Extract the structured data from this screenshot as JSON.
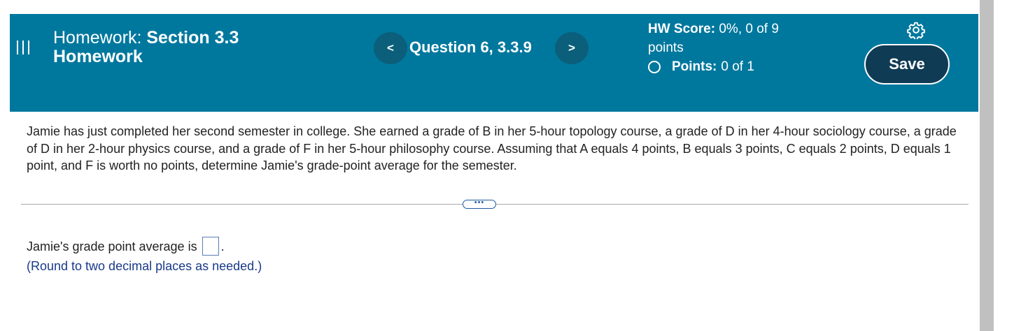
{
  "header": {
    "menu_icon": "hamburger-menu-icon",
    "title_prefix": "Homework: ",
    "title_bold": "Section 3.3 Homework",
    "prev_icon": "chevron-left-icon",
    "prev_glyph": "<",
    "question_label": "Question 6, 3.3.9",
    "next_icon": "chevron-right-icon",
    "next_glyph": ">",
    "hw_score_label": "HW Score:",
    "hw_score_value": "0%, 0 of 9 points",
    "points_label": "Points:",
    "points_value": "0 of 1",
    "settings_icon": "gear-icon",
    "save_label": "Save"
  },
  "colors": {
    "header_bg": "#00789e",
    "nav_button_bg": "#0b5f7b",
    "save_button_bg": "#0f3b55",
    "hint_text": "#1a3a8a"
  },
  "question": {
    "text": "Jamie has just completed her second semester in college. She earned a grade of B in her 5-hour topology course, a grade of D in her 4-hour sociology course, a grade of D in her 2-hour physics course, and a grade of F in her 5-hour philosophy course. Assuming that A equals 4 points, B equals 3 points, C equals 2 points, D equals 1 point, and F is worth no points, determine Jamie's grade-point average for the semester.",
    "expand_label": "•••"
  },
  "answer": {
    "prompt": "Jamie's grade point average is",
    "input_value": "",
    "suffix": ".",
    "hint": "(Round to two decimal places as needed.)"
  }
}
